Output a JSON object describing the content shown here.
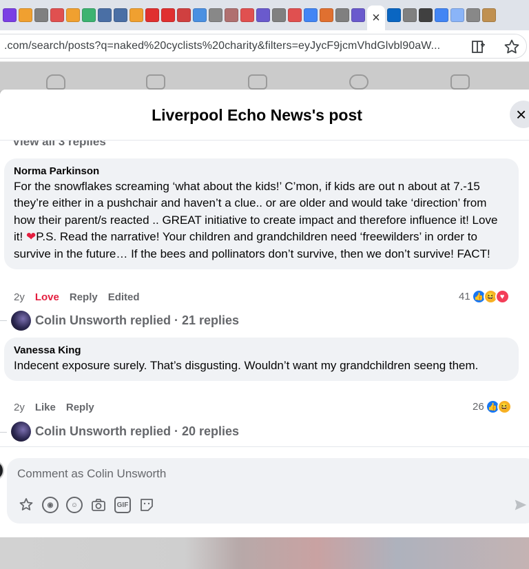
{
  "browser": {
    "url": ".com/search/posts?q=naked%20cyclists%20charity&filters=eyJycF9jcmVhdGlvbl90aW...",
    "close_tab_glyph": "×",
    "tab_favicon_colors": [
      "#7b3fe4",
      "#f0a030",
      "#808080",
      "#e05050",
      "#f0a030",
      "#3cb371",
      "#4a6fa5",
      "#4a6fa5",
      "#f0a030",
      "#e03030",
      "#e03030",
      "#d04040",
      "#4a90e2",
      "#888888",
      "#b07070",
      "#e05050",
      "#6a5acd",
      "#808080",
      "#e05050",
      "#4285f4",
      "#e07030",
      "#808080",
      "#6a5acd",
      "#0a66c2",
      "#808080",
      "#404040",
      "#4285f4",
      "#8ab4f8",
      "#888888",
      "#c09050"
    ]
  },
  "modal": {
    "title": "Liverpool Echo News's post",
    "close_glyph": "×",
    "view_replies": "View all 3 replies"
  },
  "comments": [
    {
      "author": "Norma Parkinson",
      "text_before_heart": "For the snowflakes screaming ‘what about the kids!’ C’mon, if kids are out n about at 7.-15 they’re either in a pushchair and haven’t a clue.. or are older and would take ‘direction’ from how their parent/s reacted .. GREAT initiative to create impact and therefore influence it! Love it! ",
      "heart": "❤",
      "text_after_heart": "P.S. Read the narrative! Your children and grandchildren need ‘freewilders’ in order to survive in the future… If the bees and pollinators don’t survive, then we don’t survive! FACT!",
      "age": "2y",
      "reaction_action": "Love",
      "reply_label": "Reply",
      "edited_label": "Edited",
      "reaction_count": "41",
      "replies_summary": "Colin Unsworth replied · 21 replies"
    },
    {
      "author": "Vanessa King",
      "text": "Indecent exposure surely. That’s disgusting. Wouldn’t want my grandchildren seeng them.",
      "age": "2y",
      "reaction_action": "Like",
      "reply_label": "Reply",
      "reaction_count": "26",
      "replies_summary": "Colin Unsworth replied · 20 replies"
    }
  ],
  "composer": {
    "placeholder": "Comment as Colin Unsworth",
    "gif_label": "GIF"
  }
}
